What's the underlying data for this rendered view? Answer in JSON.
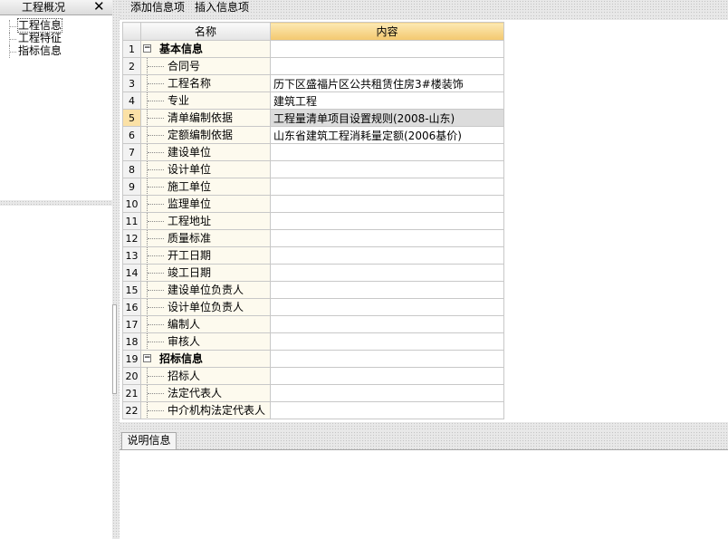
{
  "left_panel": {
    "title": "工程概况",
    "tree": [
      "工程信息",
      "工程特征",
      "指标信息"
    ]
  },
  "toolbar": {
    "add_label": "添加信息项",
    "insert_label": "插入信息项"
  },
  "grid": {
    "headers": {
      "name": "名称",
      "content": "内容"
    },
    "rows": [
      {
        "num": "1",
        "name": "基本信息",
        "content": "",
        "type": "group"
      },
      {
        "num": "2",
        "name": "合同号",
        "content": ""
      },
      {
        "num": "3",
        "name": "工程名称",
        "content": "历下区盛福片区公共租赁住房3#楼装饰"
      },
      {
        "num": "4",
        "name": "专业",
        "content": "建筑工程"
      },
      {
        "num": "5",
        "name": "清单编制依据",
        "content": "工程量清单项目设置规则(2008-山东)",
        "selected": true
      },
      {
        "num": "6",
        "name": "定额编制依据",
        "content": "山东省建筑工程消耗量定额(2006基价)"
      },
      {
        "num": "7",
        "name": "建设单位",
        "content": ""
      },
      {
        "num": "8",
        "name": "设计单位",
        "content": ""
      },
      {
        "num": "9",
        "name": "施工单位",
        "content": ""
      },
      {
        "num": "10",
        "name": "监理单位",
        "content": ""
      },
      {
        "num": "11",
        "name": "工程地址",
        "content": ""
      },
      {
        "num": "12",
        "name": "质量标准",
        "content": ""
      },
      {
        "num": "13",
        "name": "开工日期",
        "content": ""
      },
      {
        "num": "14",
        "name": "竣工日期",
        "content": ""
      },
      {
        "num": "15",
        "name": "建设单位负责人",
        "content": ""
      },
      {
        "num": "16",
        "name": "设计单位负责人",
        "content": ""
      },
      {
        "num": "17",
        "name": "编制人",
        "content": ""
      },
      {
        "num": "18",
        "name": "审核人",
        "content": ""
      },
      {
        "num": "19",
        "name": "招标信息",
        "content": "",
        "type": "group"
      },
      {
        "num": "20",
        "name": "招标人",
        "content": ""
      },
      {
        "num": "21",
        "name": "法定代表人",
        "content": ""
      },
      {
        "num": "22",
        "name": "中介机构法定代表人",
        "content": ""
      }
    ]
  },
  "bottom": {
    "tab_label": "说明信息"
  }
}
